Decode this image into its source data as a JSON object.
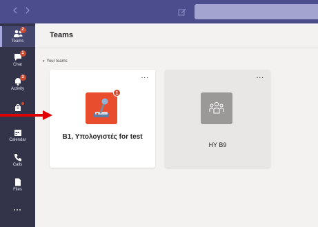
{
  "topbar": {
    "back_icon": "chevron-left-icon",
    "forward_icon": "chevron-right-icon",
    "compose_icon": "compose-icon"
  },
  "rail": {
    "items": [
      {
        "id": "teams",
        "label": "Teams",
        "icon": "teams-icon",
        "badge": "2",
        "active": true
      },
      {
        "id": "chat",
        "label": "Chat",
        "icon": "chat-icon",
        "badge": "1"
      },
      {
        "id": "activity",
        "label": "Activity",
        "icon": "bell-icon",
        "badge": "3"
      },
      {
        "id": "apps",
        "label": "",
        "icon": "bag-icon",
        "dot": true
      },
      {
        "id": "calendar",
        "label": "Calendar",
        "icon": "calendar-icon"
      },
      {
        "id": "calls",
        "label": "Calls",
        "icon": "phone-icon"
      },
      {
        "id": "files",
        "label": "Files",
        "icon": "file-icon"
      },
      {
        "id": "more",
        "label": "",
        "icon": "more-icon",
        "text": "..."
      }
    ]
  },
  "header": {
    "title": "Teams"
  },
  "section": {
    "label": "Your teams",
    "caret": "▾"
  },
  "teams": [
    {
      "name": "B1, Υπολογιστές for test",
      "badge": "1",
      "tile_color": "#e84e2e",
      "icon": "joystick-icon",
      "more": "..."
    },
    {
      "name": "HY B9",
      "tile_color": "#9a9998",
      "icon": "team-people-icon",
      "more": "..."
    }
  ],
  "colors": {
    "topbar": "#4b4d8c",
    "rail": "#33344a",
    "badge": "#cc4a31",
    "annotation_arrow": "#e00000"
  }
}
